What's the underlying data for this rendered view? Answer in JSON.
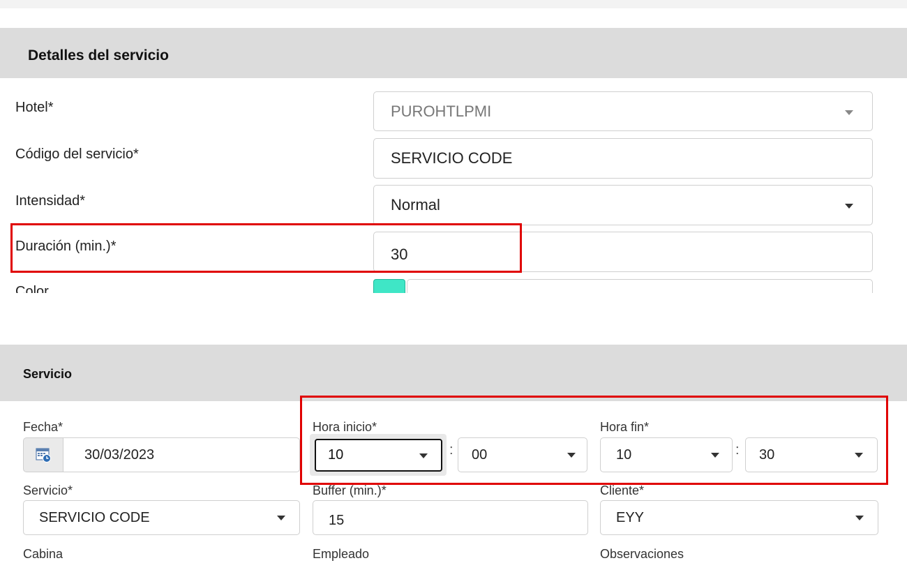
{
  "detalles": {
    "title": "Detalles del servicio",
    "hotel_label": "Hotel*",
    "hotel_value": "PUROHTLPMI",
    "codigo_label": "Código del servicio*",
    "codigo_value": "SERVICIO CODE",
    "intensidad_label": "Intensidad*",
    "intensidad_value": "Normal",
    "duracion_label": "Duración (min.)*",
    "duracion_value": "30",
    "color_label": "Color",
    "color_value": "#3fe6c6"
  },
  "servicio": {
    "title": "Servicio",
    "fecha_label": "Fecha*",
    "fecha_value": "30/03/2023",
    "hora_inicio_label": "Hora inicio*",
    "hora_inicio_h": "10",
    "hora_inicio_m": "00",
    "hora_fin_label": "Hora fin*",
    "hora_fin_h": "10",
    "hora_fin_m": "30",
    "time_sep": ":",
    "servicio_label": "Servicio*",
    "servicio_value": "SERVICIO CODE",
    "buffer_label": "Buffer (min.)*",
    "buffer_value": "15",
    "cliente_label": "Cliente*",
    "cliente_value": "EYY",
    "cabina_label": "Cabina",
    "empleado_label": "Empleado",
    "observaciones_label": "Observaciones"
  },
  "colors": {
    "highlight": "#e00000",
    "header_bg": "#dcdcdc"
  }
}
